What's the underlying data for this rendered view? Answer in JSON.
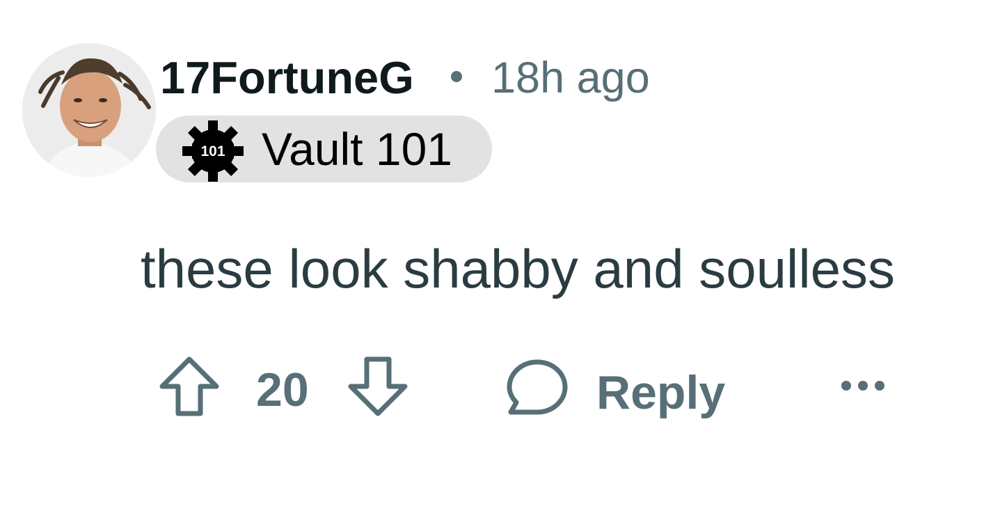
{
  "comment": {
    "author": "17FortuneG",
    "timestamp": "18h ago",
    "flair": {
      "badge_text": "101",
      "label": "Vault 101",
      "background": "#e2e2e2",
      "icon": "vault-gear-icon"
    },
    "body": "these look shabby and soulless",
    "score": "20",
    "reply_label": "Reply"
  },
  "colors": {
    "author": "#0f1a1c",
    "meta": "#576f76",
    "body_text": "#2a3c42"
  },
  "icons": {
    "upvote": "upvote-arrow-icon",
    "downvote": "downvote-arrow-icon",
    "reply": "speech-bubble-icon",
    "more": "overflow-dots-icon"
  }
}
